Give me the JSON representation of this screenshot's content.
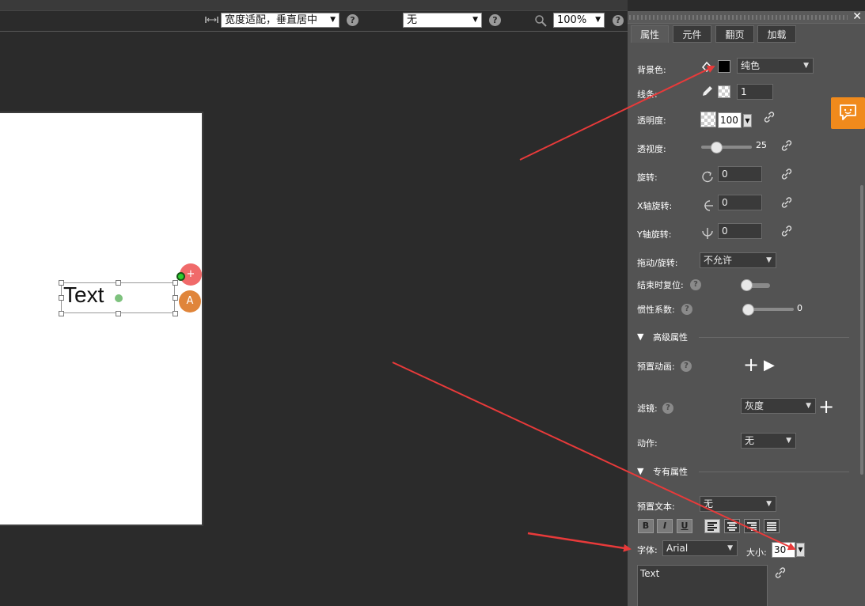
{
  "toolbar": {
    "fit_icon": "fit-width-icon",
    "fit_select": "宽度适配，垂直居中",
    "effect_select": "无",
    "zoom_icon": "magnifier-icon",
    "zoom_select": "100%",
    "help_label": "?"
  },
  "canvas": {
    "text_element": "Text",
    "fab_add_label": "A",
    "fab_plus": "+"
  },
  "panel": {
    "close_label": "✕",
    "tabs": [
      "属性",
      "元件",
      "翻页",
      "加载"
    ],
    "active_tab": "属性",
    "background_color_label": "背景色:",
    "background_fill_select": "纯色",
    "background_swatch": "#000000",
    "border_label": "线条:",
    "border_width": "1",
    "opacity_label": "透明度:",
    "opacity_value": "100",
    "perspective_label": "透视度:",
    "perspective_value": "25",
    "perspective_fraction": 0.25,
    "rotation_label": "旋转:",
    "rotation_value": "0",
    "x_rotation_label": "X轴旋转:",
    "x_rotation_value": "0",
    "y_rotation_label": "Y轴旋转:",
    "y_rotation_value": "0",
    "drag_rotate_label": "拖动/旋转:",
    "drag_rotate_select": "不允许",
    "reset_on_end_label": "结束时复位:",
    "reset_on_end_enabled": false,
    "inertia_label": "惯性系数:",
    "inertia_value": "0",
    "inertia_fraction": 0,
    "advanced_section": "高级属性",
    "preset_animation_label": "预置动画:",
    "filter_label": "滤镜:",
    "filter_select": "灰度",
    "action_label": "动作:",
    "action_select": "无",
    "special_section": "专有属性",
    "preset_text_label": "预置文本:",
    "preset_text_select": "无",
    "bold_label": "B",
    "italic_label": "I",
    "underline_label": "U",
    "active_alignment": "left",
    "font_label": "字体:",
    "font_select": "Arial",
    "size_label": "大小:",
    "size_value": "30",
    "text_content": "Text",
    "add_label": "+",
    "play_label": "▶"
  },
  "colors": {
    "accent_orange": "#f08a1c",
    "annotation_arrow": "#e83a3a",
    "panel_bg": "#535353",
    "workspace_bg": "#2b2b2b"
  },
  "icons": {
    "feedback": "chat-bubble-icon",
    "link": "link-icon",
    "paint_bucket": "paint-bucket-icon",
    "pencil": "pencil-icon",
    "rotate": "rotate-icon",
    "x_rotate": "x-axis-rotate-icon",
    "y_rotate": "y-axis-rotate-icon"
  }
}
